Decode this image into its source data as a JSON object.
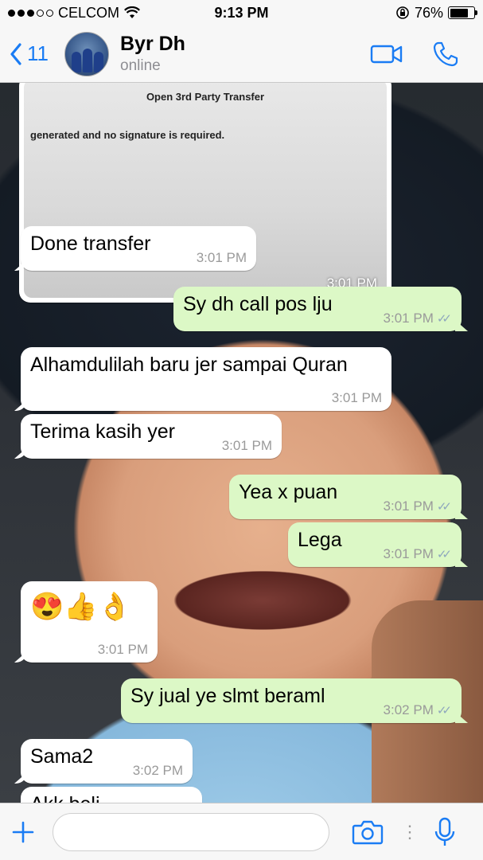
{
  "status_bar": {
    "carrier": "CELCOM",
    "time": "9:13 PM",
    "battery_percent": "76%",
    "battery_level": 0.76
  },
  "header": {
    "back_count": "11",
    "contact_name": "Byr Dh",
    "contact_status": "online"
  },
  "messages": [
    {
      "type": "image",
      "direction": "in",
      "doc_text_1": "Open 3rd Party Transfer",
      "doc_text_2": "generated and no signature is required.",
      "time": "3:01 PM"
    },
    {
      "direction": "in",
      "text": "Done transfer",
      "time": "3:01 PM"
    },
    {
      "direction": "out",
      "text": "Sy dh call pos lju",
      "time": "3:01 PM",
      "ticks": "✓✓"
    },
    {
      "direction": "in",
      "text": "Alhamdulilah baru jer sampai Quran",
      "time": "3:01 PM"
    },
    {
      "direction": "in",
      "text": "Terima kasih yer",
      "time": "3:01 PM"
    },
    {
      "direction": "out",
      "text": "Yea x puan",
      "time": "3:01 PM",
      "ticks": "✓✓"
    },
    {
      "direction": "out",
      "text": "Lega",
      "time": "3:01 PM",
      "ticks": "✓✓"
    },
    {
      "direction": "in",
      "text": "😍👍👌",
      "time": "3:01 PM"
    },
    {
      "direction": "out",
      "text": "Sy jual ye slmt beraml",
      "time": "3:02 PM",
      "ticks": "✓✓"
    },
    {
      "direction": "in",
      "text": "Sama2",
      "time": "3:02 PM"
    },
    {
      "direction": "in",
      "text": "Akk beli",
      "time": ""
    }
  ],
  "input": {
    "placeholder": "",
    "value": ""
  },
  "colors": {
    "accent": "#1a7cf4",
    "outgoing_bubble": "#dcf8c6",
    "incoming_bubble": "#ffffff"
  },
  "icons": {
    "back": "chevron-left-icon",
    "video": "video-camera-icon",
    "call": "phone-icon",
    "attach": "plus-icon",
    "camera": "camera-icon",
    "mic": "microphone-icon"
  }
}
